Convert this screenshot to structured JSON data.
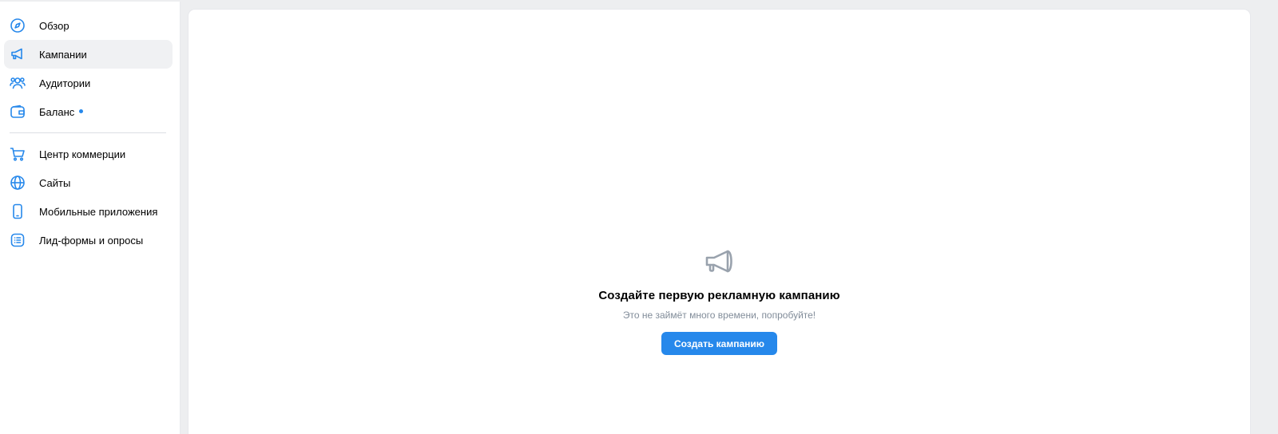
{
  "sidebar": {
    "items": [
      {
        "label": "Обзор",
        "icon": "compass-icon",
        "active": false
      },
      {
        "label": "Кампании",
        "icon": "megaphone-icon",
        "active": true
      },
      {
        "label": "Аудитории",
        "icon": "users-icon",
        "active": false
      },
      {
        "label": "Баланс",
        "icon": "wallet-icon",
        "active": false,
        "badge_dot": true
      },
      {
        "label": "Центр коммерции",
        "icon": "cart-icon",
        "active": false
      },
      {
        "label": "Сайты",
        "icon": "globe-icon",
        "active": false
      },
      {
        "label": "Мобильные приложения",
        "icon": "smartphone-icon",
        "active": false
      },
      {
        "label": "Лид-формы и опросы",
        "icon": "list-form-icon",
        "active": false
      }
    ]
  },
  "empty_state": {
    "icon": "megaphone-icon",
    "title": "Создайте первую рекламную кампанию",
    "subtitle": "Это не займёт много времени, попробуйте!",
    "button_label": "Создать кампанию"
  },
  "colors": {
    "accent": "#2688eb",
    "page_background": "#edeef0",
    "active_item_background": "#f0f1f3",
    "secondary_text": "#818c99",
    "empty_icon": "#99a2ad"
  }
}
